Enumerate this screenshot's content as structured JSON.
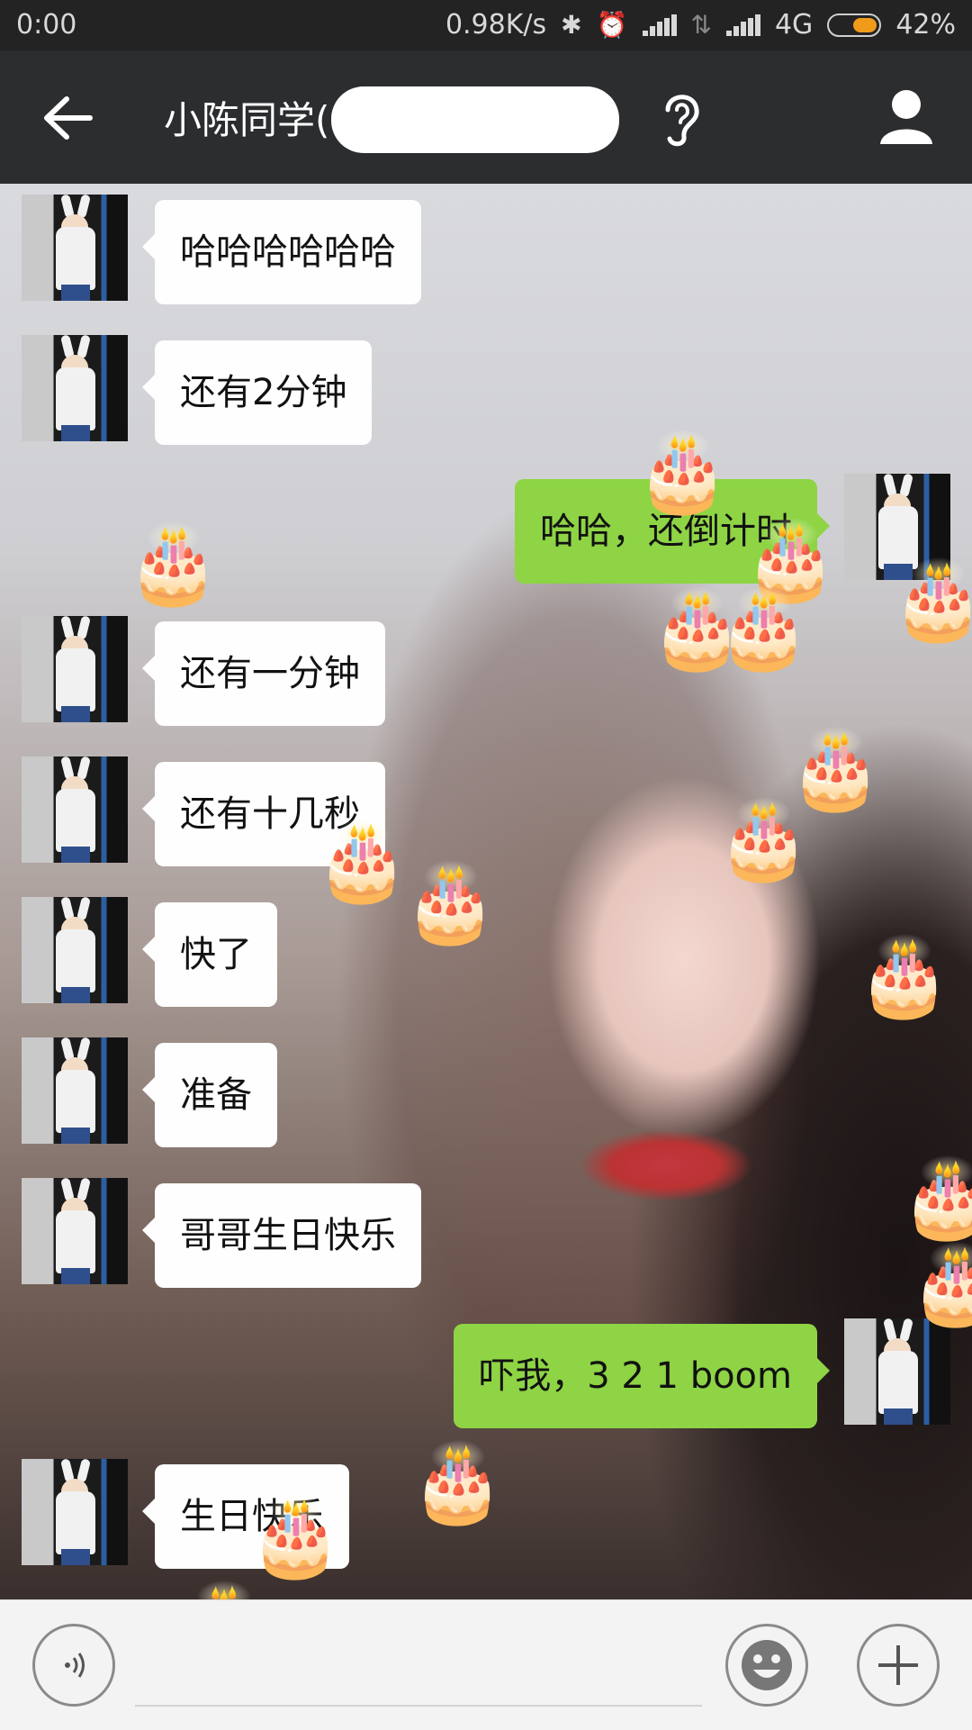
{
  "status_bar": {
    "time": "0:00",
    "net_speed": "0.98K/s",
    "network": "4G",
    "battery": "42%",
    "icons": [
      "bluetooth-icon",
      "alarm-icon",
      "signal-icon",
      "data-arrows-icon",
      "signal-icon"
    ]
  },
  "header": {
    "title": "小陈同学(",
    "icons": [
      "back-arrow-icon",
      "ear-icon",
      "person-icon"
    ]
  },
  "messages": [
    {
      "side": "in",
      "text": "哈哈哈哈哈哈"
    },
    {
      "side": "in",
      "text": "还有2分钟"
    },
    {
      "side": "out",
      "text": "哈哈，还倒计时"
    },
    {
      "side": "in",
      "text": "还有一分钟"
    },
    {
      "side": "in",
      "text": "还有十几秒"
    },
    {
      "side": "in",
      "text": "快了"
    },
    {
      "side": "in",
      "text": "准备"
    },
    {
      "side": "in",
      "text": "哥哥生日快乐"
    },
    {
      "side": "out",
      "text": "吓我，3 2 1 boom"
    },
    {
      "side": "in",
      "text": "生日快乐"
    }
  ],
  "decorations": {
    "cake_emoji": "🎂",
    "cake_icon": "birthday-cake-icon"
  },
  "input_bar": {
    "icons": [
      "voice-icon",
      "emoji-icon",
      "plus-icon"
    ]
  },
  "colors": {
    "outgoing_bubble": "#8ed445",
    "incoming_bubble": "#fefefe",
    "header_bg": "#2b2d2f"
  }
}
